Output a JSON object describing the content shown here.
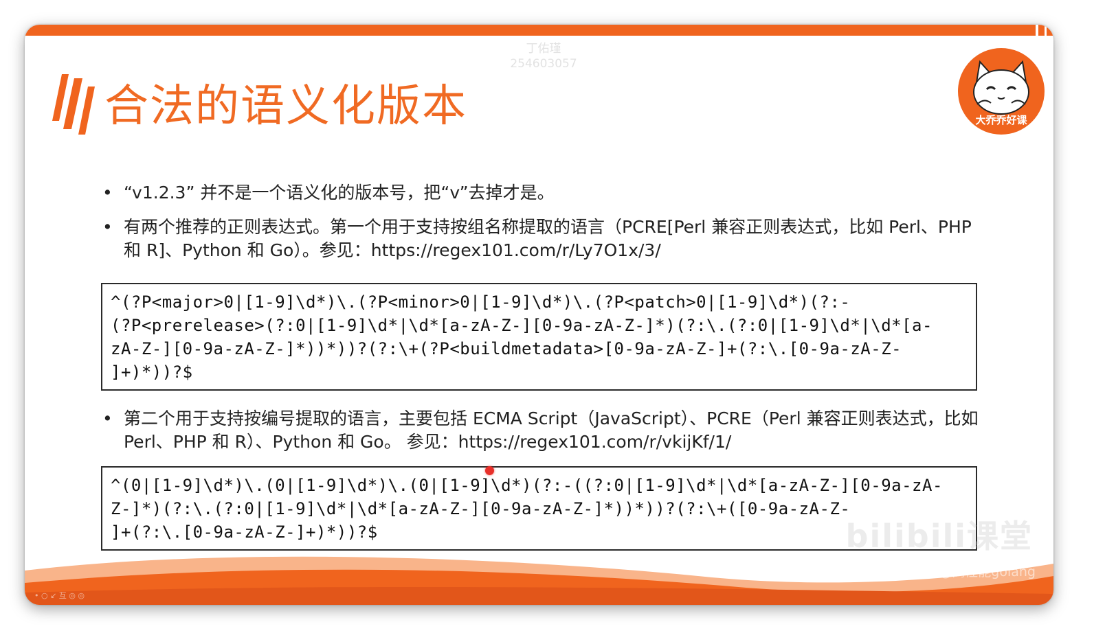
{
  "slide": {
    "title": "合法的语义化版本",
    "watermark_top_line1": "丁佑瑾",
    "watermark_top_line2": "254603057",
    "logo_text": "大乔乔好课",
    "bullets": [
      {
        "marker": "•",
        "text": "“v1.2.3” 并不是一个语义化的版本号，把“v”去掉才是。"
      },
      {
        "marker": "•",
        "text": "有两个推荐的正则表达式。第一个用于支持按组名称提取的语言（PCRE[Perl 兼容正则表达式，比如 Perl、PHP 和 R]、Python 和 Go）。参见：https://regex101.com/r/Ly7O1x/3/"
      },
      {
        "marker": "•",
        "text": "第二个用于支持按编号提取的语言，主要包括 ECMA Script（JavaScript）、PCRE（Perl 兼容正则表达式，比如 Perl、PHP 和 R）、Python 和 Go。 参见：https://regex101.com/r/vkijKf/1/"
      }
    ],
    "code_block_1": [
      "^(?P<major>0|[1-9]\\d*)\\.(?P<minor>0|[1-9]\\d*)\\.(?P<patch>0|[1-9]\\d*)(?:-",
      "(?P<prerelease>(?:0|[1-9]\\d*|\\d*[a-zA-Z-][0-9a-zA-Z-]*)(?:\\.(?:0|[1-9]\\d*|\\d*[a-",
      "zA-Z-][0-9a-zA-Z-]*))*))?(?:\\+(?P<buildmetadata>[0-9a-zA-Z-]+(?:\\.[0-9a-zA-Z-",
      "]+)*))?$"
    ],
    "code_block_2": [
      "^(0|[1-9]\\d*)\\.(0|[1-9]\\d*)\\.(0|[1-9]\\d*)(?:-((?:0|[1-9]\\d*|\\d*[a-zA-Z-][0-9a-zA-",
      "Z-]*)(?:\\.(?:0|[1-9]\\d*|\\d*[a-zA-Z-][0-9a-zA-Z-]*))*))?(?:\\+([0-9a-zA-Z-",
      "]+(?:\\.[0-9a-zA-Z-]+)*))?$"
    ],
    "bili_watermark": "bilibili课堂",
    "bili_author": "@高性能golang",
    "bottom_left_caption": "• ○ ↙ 互 ◎ ◎"
  },
  "colors": {
    "accent_orange": "#f0641e",
    "title_orange": "#f06a23",
    "pointer_red": "#e8302a"
  }
}
